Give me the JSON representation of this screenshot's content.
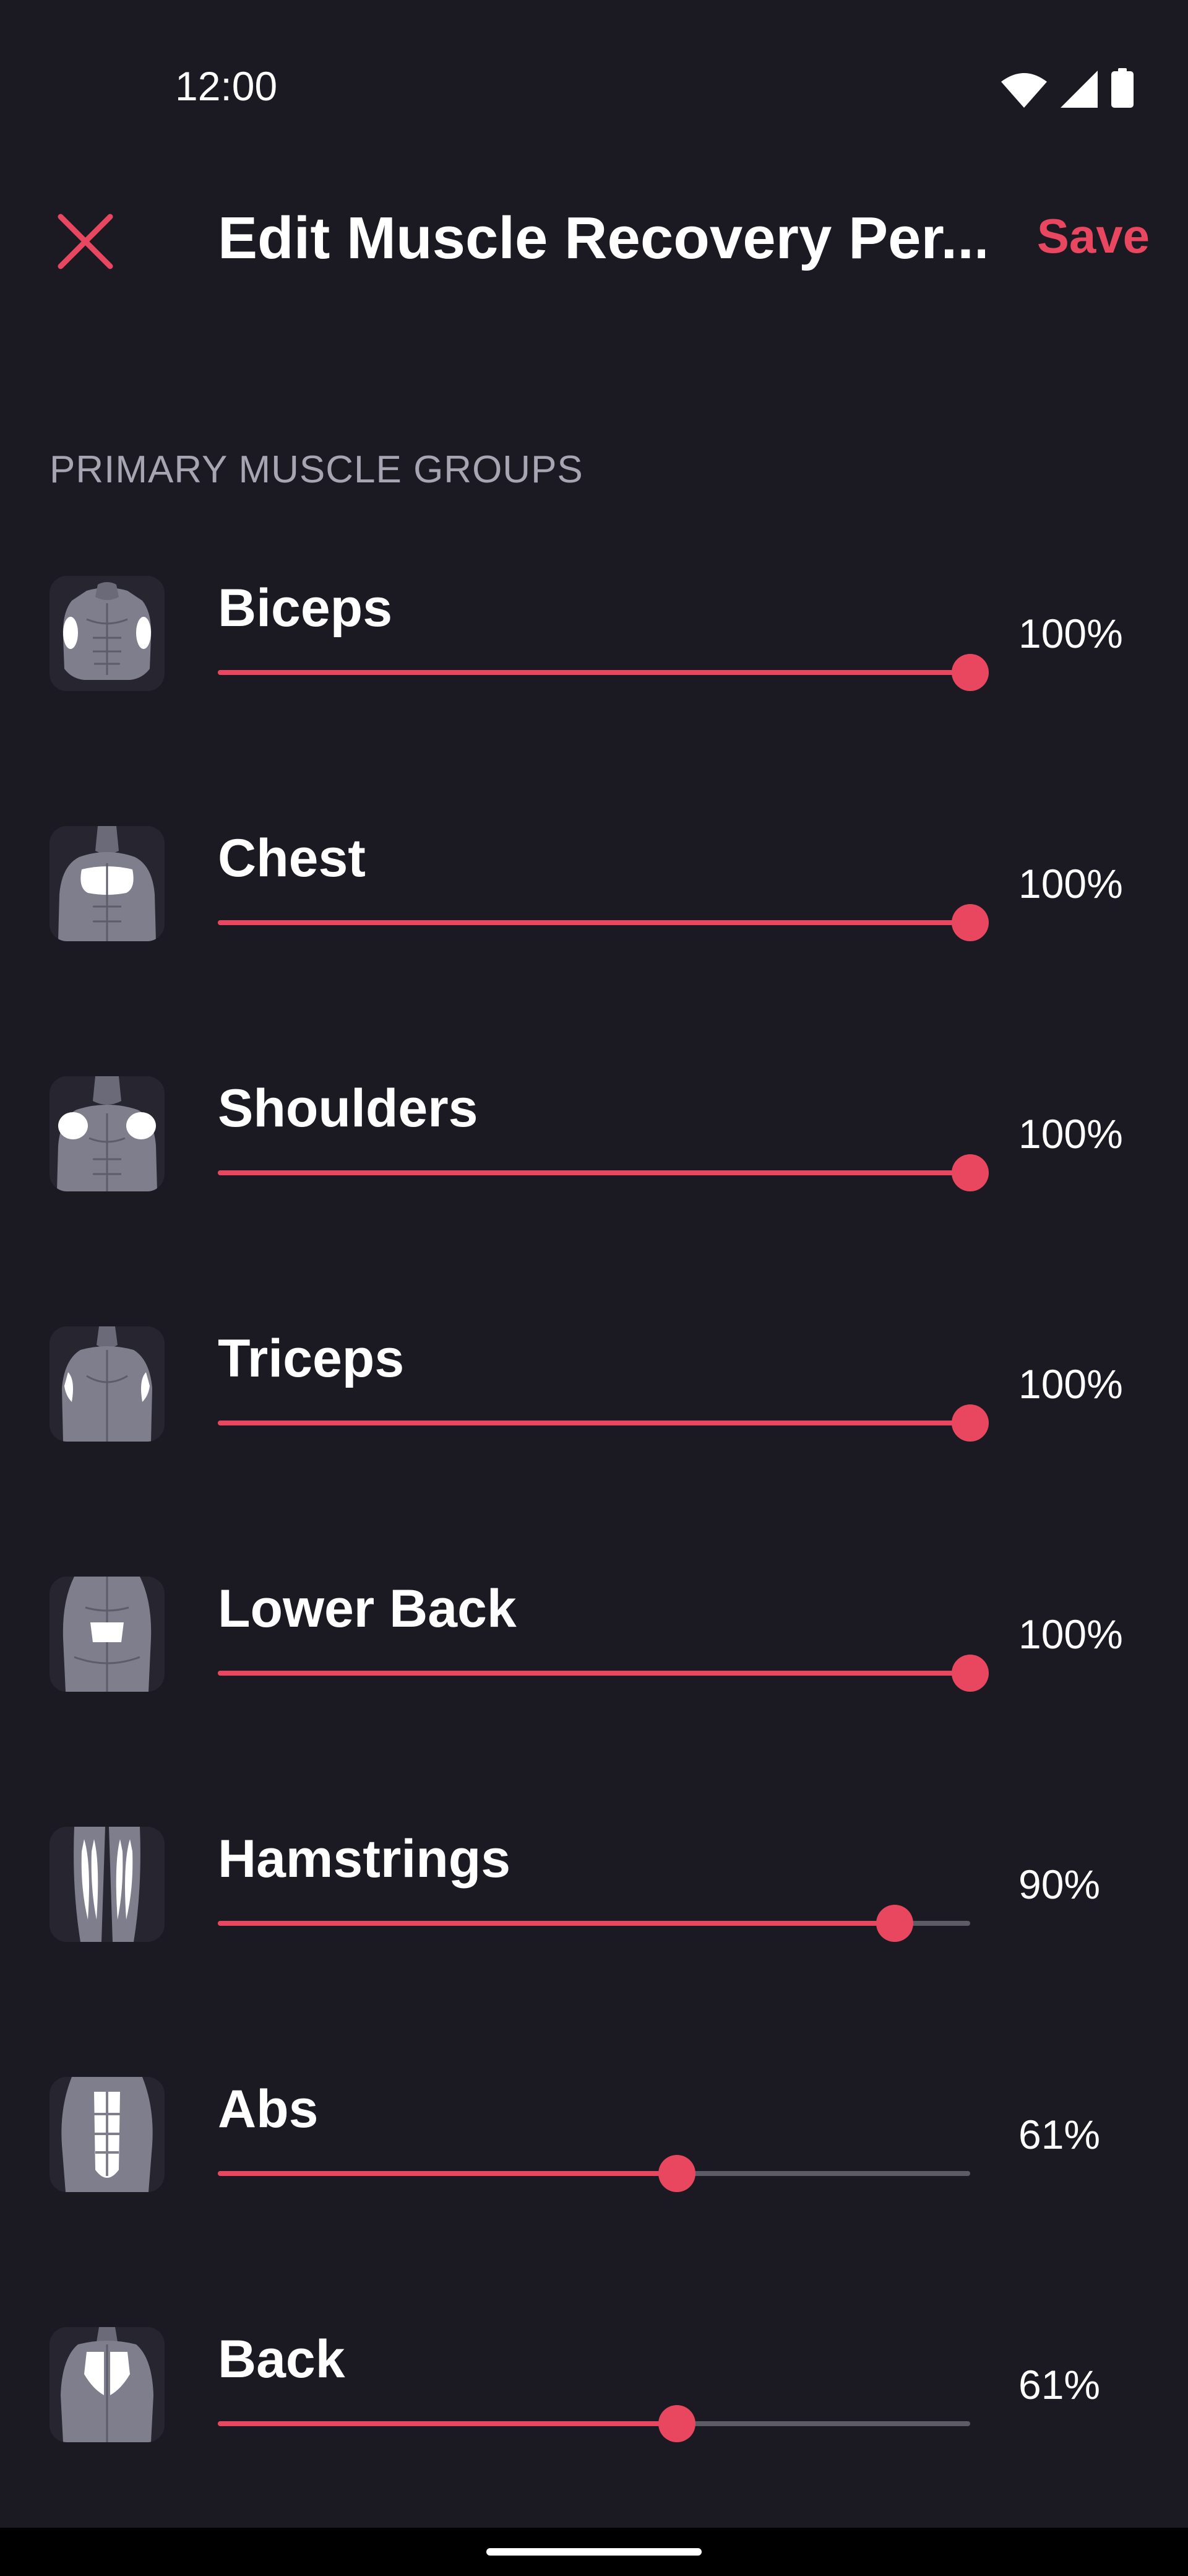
{
  "status_bar": {
    "time": "12:00",
    "icons": [
      "wifi-icon",
      "cellular-signal-icon",
      "battery-icon"
    ]
  },
  "app_bar": {
    "close_icon": "close-icon",
    "title": "Edit Muscle Recovery Per...",
    "save_label": "Save"
  },
  "section": {
    "header": "PRIMARY MUSCLE GROUPS"
  },
  "colors": {
    "background": "#1b1a22",
    "accent": "#e8475f",
    "track_inactive": "#5d5c66",
    "secondary_text": "#a6a5b1"
  },
  "muscles": [
    {
      "name": "Biceps",
      "value_label": "100%",
      "value": 100,
      "icon": "biceps-muscle-icon"
    },
    {
      "name": "Chest",
      "value_label": "100%",
      "value": 100,
      "icon": "chest-muscle-icon"
    },
    {
      "name": "Shoulders",
      "value_label": "100%",
      "value": 100,
      "icon": "shoulders-muscle-icon"
    },
    {
      "name": "Triceps",
      "value_label": "100%",
      "value": 100,
      "icon": "triceps-muscle-icon"
    },
    {
      "name": "Lower Back",
      "value_label": "100%",
      "value": 100,
      "icon": "lower-back-muscle-icon"
    },
    {
      "name": "Hamstrings",
      "value_label": "90%",
      "value": 90,
      "icon": "hamstrings-muscle-icon"
    },
    {
      "name": "Abs",
      "value_label": "61%",
      "value": 61,
      "icon": "abs-muscle-icon"
    },
    {
      "name": "Back",
      "value_label": "61%",
      "value": 61,
      "icon": "back-muscle-icon"
    }
  ]
}
